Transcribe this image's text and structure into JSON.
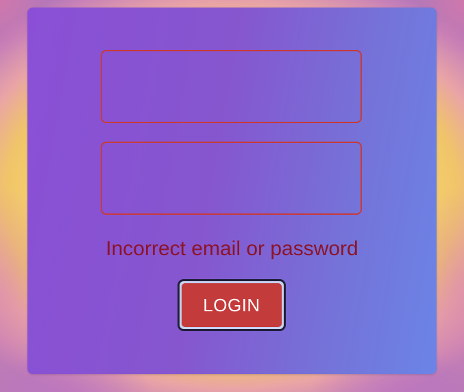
{
  "login_form": {
    "email_field": {
      "value": "",
      "placeholder": ""
    },
    "password_field": {
      "value": "",
      "placeholder": ""
    },
    "error_message": "Incorrect email or password",
    "login_button_label": "LOGIN"
  },
  "colors": {
    "card_gradient_start": "#8a4fd6",
    "card_gradient_end": "#6b84e6",
    "field_border": "#c73a3a",
    "error_text": "#8c1428",
    "button_fill": "#c43b3b",
    "button_outline": "#1f1f3a",
    "background": "#f7d56c"
  }
}
